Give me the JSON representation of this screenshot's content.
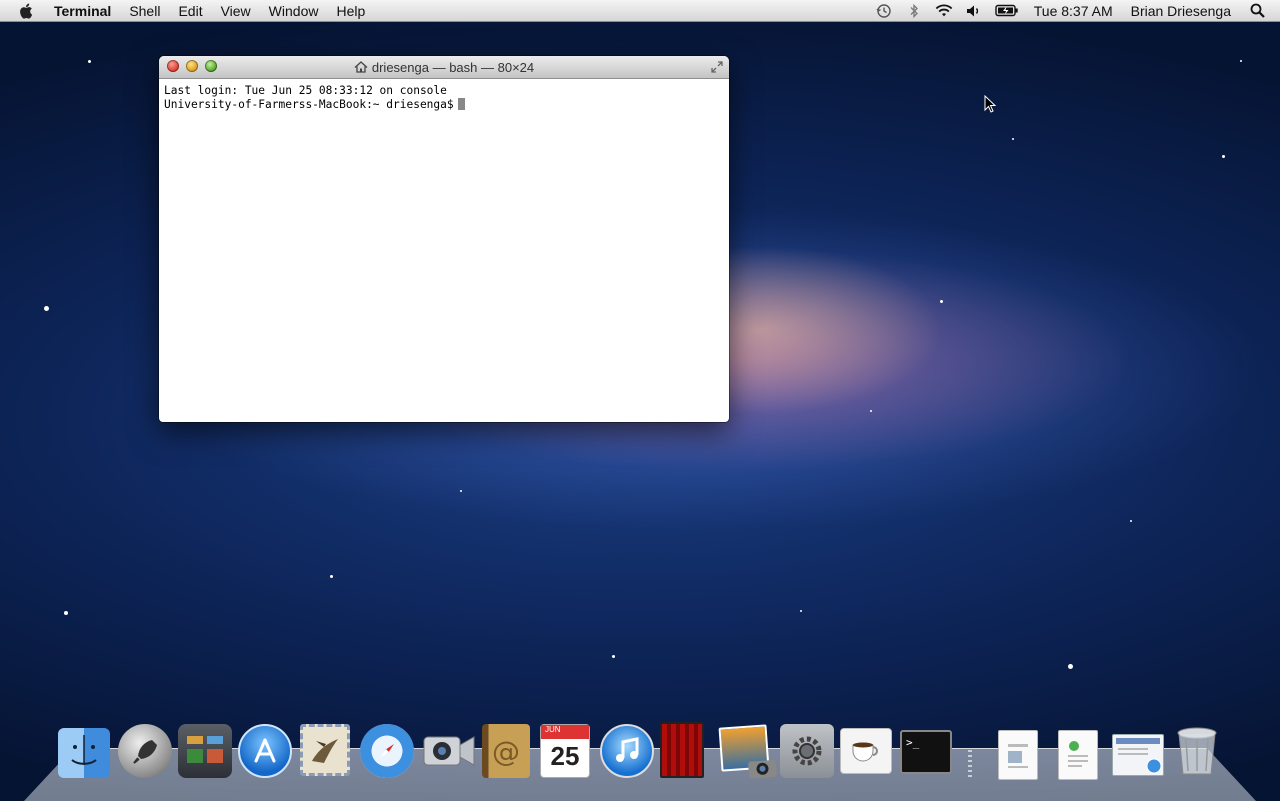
{
  "menubar": {
    "apple_icon": "apple-icon",
    "app_name": "Terminal",
    "menus": [
      "Shell",
      "Edit",
      "View",
      "Window",
      "Help"
    ],
    "status_icons": [
      "time-machine-icon",
      "bluetooth-icon",
      "wifi-icon",
      "volume-icon",
      "battery-icon"
    ],
    "clock": "Tue 8:37 AM",
    "user": "Brian Driesenga",
    "spotlight_icon": "spotlight-search-icon"
  },
  "terminal": {
    "title": "driesenga — bash — 80×24",
    "lines": [
      "Last login: Tue Jun 25 08:33:12 on console",
      "University-of-Farmerss-MacBook:~ driesenga$"
    ]
  },
  "dock": {
    "apps": [
      "finder-icon",
      "launchpad-icon",
      "mission-control-icon",
      "app-store-icon",
      "mail-icon",
      "safari-icon",
      "facetime-icon",
      "address-book-icon",
      "calendar-icon",
      "itunes-icon",
      "photo-booth-icon",
      "iphoto-icon",
      "system-preferences-icon",
      "coffee-app-icon",
      "terminal-icon"
    ],
    "calendar_month": "JUN",
    "calendar_day": "25",
    "stack_items": [
      "document-stack-icon",
      "downloads-stack-icon",
      "web-document-icon",
      "trash-icon"
    ]
  },
  "colors": {
    "menubar_bg": "#e4e4e4",
    "desktop_bg": "#0d2457",
    "terminal_bg": "#ffffff"
  }
}
